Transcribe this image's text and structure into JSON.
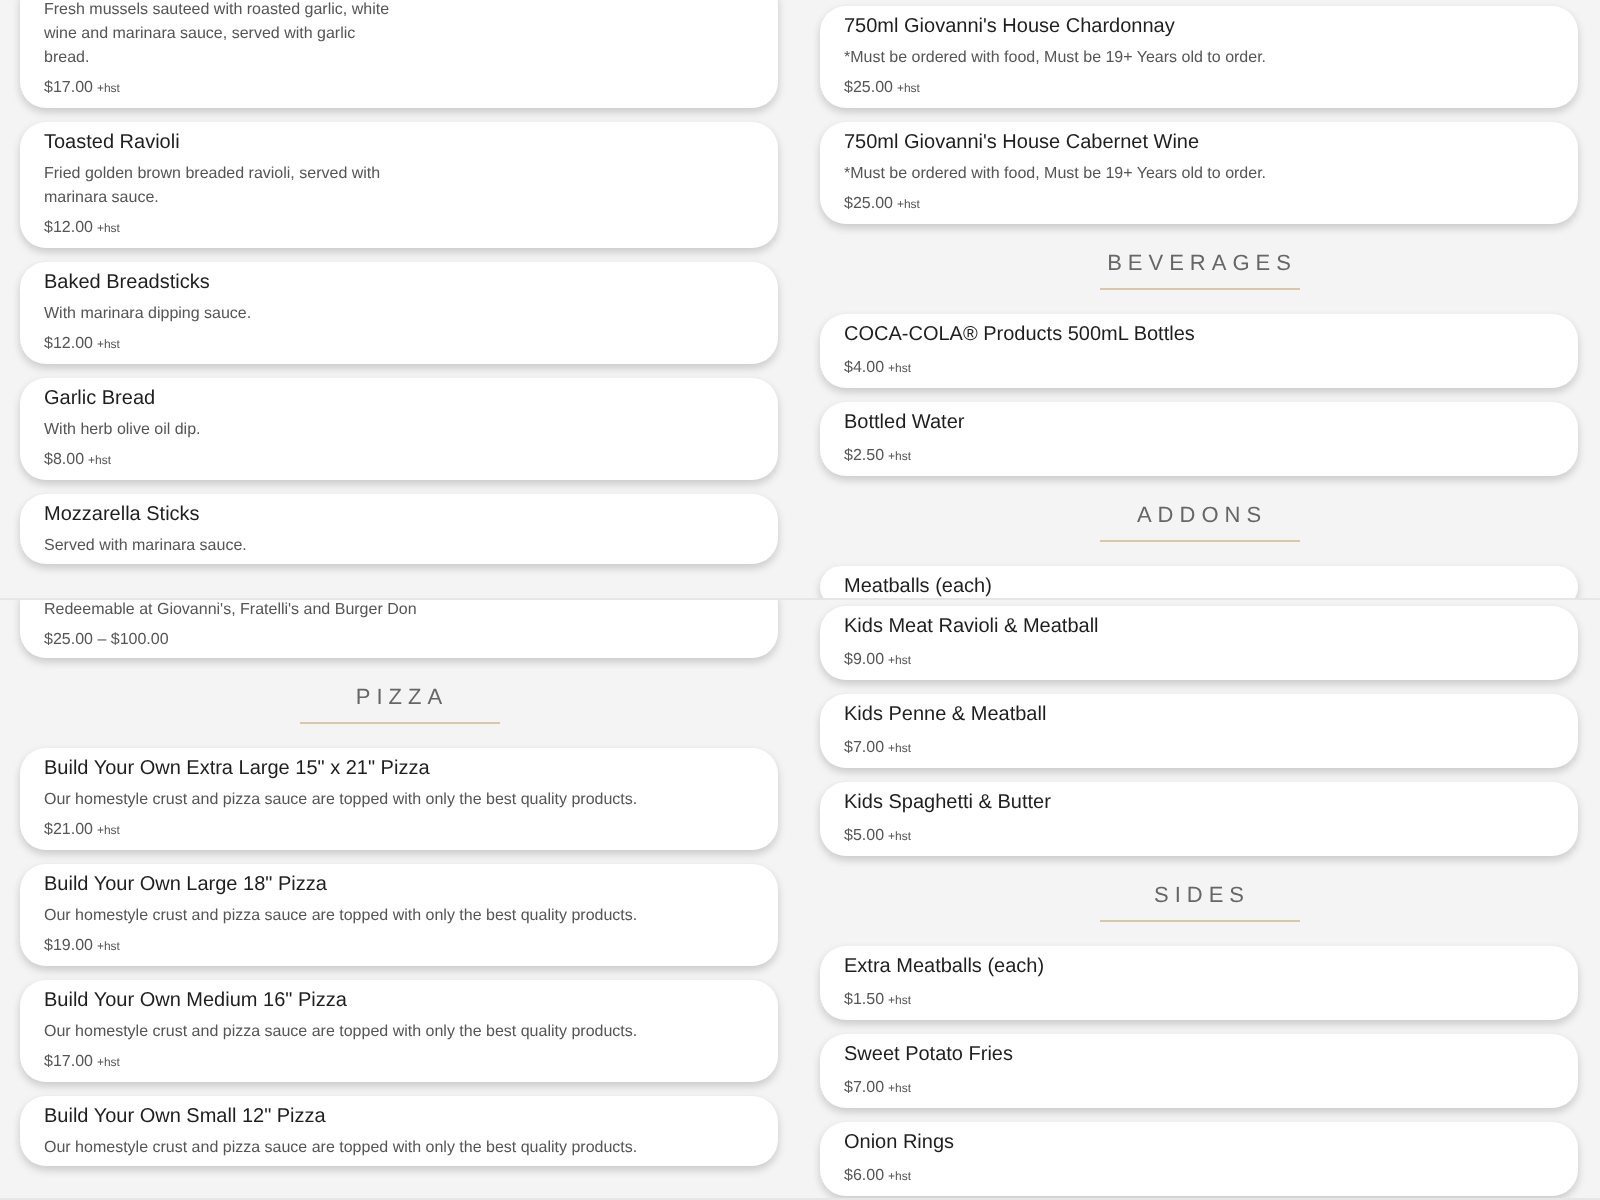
{
  "panels": [
    {
      "sections": [
        {
          "items": [
            {
              "description": "Fresh mussels sauteed with roasted garlic, white wine and marinara sauce, served with garlic bread.",
              "price": "$17.00",
              "tax": "+hst"
            },
            {
              "name": "Toasted Ravioli",
              "description": "Fried golden brown breaded ravioli, served with marinara sauce.",
              "price": "$12.00",
              "tax": "+hst"
            },
            {
              "name": "Baked Breadsticks",
              "description": "With marinara dipping sauce.",
              "price": "$12.00",
              "tax": "+hst"
            },
            {
              "name": "Garlic Bread",
              "description": "With herb olive oil dip.",
              "price": "$8.00",
              "tax": "+hst"
            },
            {
              "name": "Mozzarella Sticks",
              "description": "Served with marinara sauce."
            }
          ]
        }
      ]
    },
    {
      "sections": [
        {
          "items": [
            {
              "name": "750ml Giovanni's House Chardonnay",
              "description": "*Must be ordered with food, Must be 19+ Years old to order.",
              "price": "$25.00",
              "tax": "+hst"
            },
            {
              "name": "750ml Giovanni's House Cabernet Wine",
              "description": "*Must be ordered with food, Must be 19+ Years old to order.",
              "price": "$25.00",
              "tax": "+hst"
            }
          ]
        },
        {
          "heading": "BEVERAGES",
          "items": [
            {
              "name": "COCA-COLA® Products 500mL Bottles",
              "price": "$4.00",
              "tax": "+hst"
            },
            {
              "name": "Bottled Water",
              "price": "$2.50",
              "tax": "+hst"
            }
          ]
        },
        {
          "heading": "ADDONS",
          "items": [
            {
              "name": "Meatballs (each)"
            }
          ]
        }
      ]
    },
    {
      "sections": [
        {
          "items": [
            {
              "description": "Redeemable at Giovanni's, Fratelli's and Burger Don",
              "price": "$25.00 – $100.00"
            }
          ]
        },
        {
          "heading": "PIZZA",
          "items": [
            {
              "name": "Build Your Own Extra Large 15\" x 21\" Pizza",
              "description": "Our homestyle crust and pizza sauce are topped with only the best quality products.",
              "price": "$21.00",
              "tax": "+hst"
            },
            {
              "name": "Build Your Own Large 18\" Pizza",
              "description": "Our homestyle crust and pizza sauce are topped with only the best quality products.",
              "price": "$19.00",
              "tax": "+hst"
            },
            {
              "name": "Build Your Own Medium 16\" Pizza",
              "description": "Our homestyle crust and pizza sauce are topped with only the best quality products.",
              "price": "$17.00",
              "tax": "+hst"
            },
            {
              "name": "Build Your Own Small 12\" Pizza",
              "description": "Our homestyle crust and pizza sauce are topped with only the best quality products."
            }
          ]
        }
      ]
    },
    {
      "sections": [
        {
          "items": [
            {
              "name": "Kids Meat Ravioli & Meatball",
              "price": "$9.00",
              "tax": "+hst"
            },
            {
              "name": "Kids Penne & Meatball",
              "price": "$7.00",
              "tax": "+hst"
            },
            {
              "name": "Kids Spaghetti & Butter",
              "price": "$5.00",
              "tax": "+hst"
            }
          ]
        },
        {
          "heading": "SIDES",
          "items": [
            {
              "name": "Extra Meatballs (each)",
              "price": "$1.50",
              "tax": "+hst"
            },
            {
              "name": "Sweet Potato Fries",
              "price": "$7.00",
              "tax": "+hst"
            },
            {
              "name": "Onion Rings",
              "price": "$6.00",
              "tax": "+hst"
            }
          ]
        }
      ]
    }
  ]
}
